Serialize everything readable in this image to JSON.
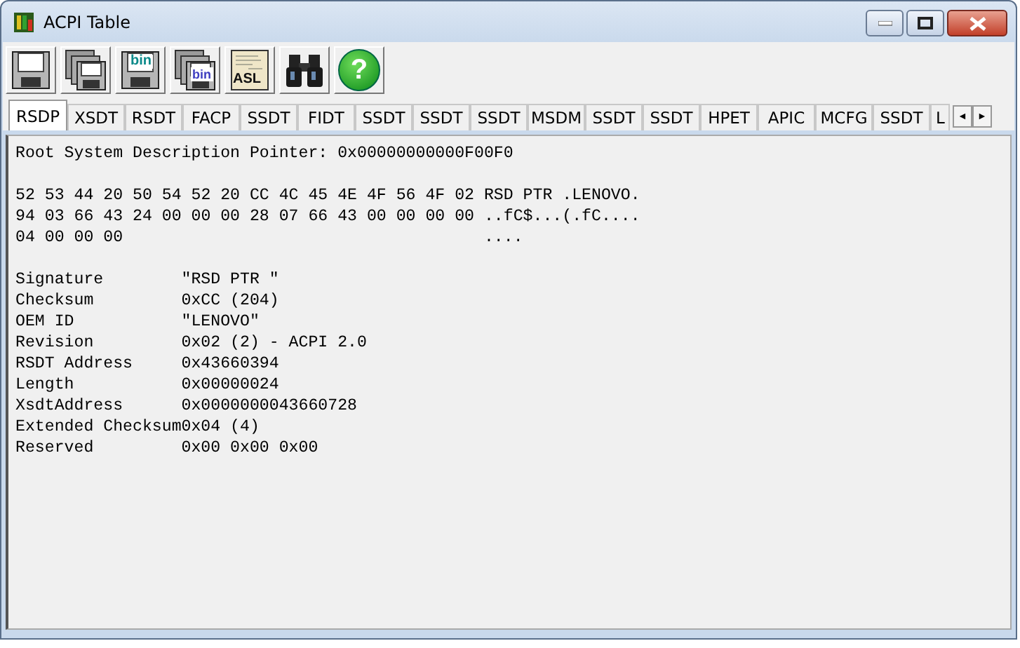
{
  "window": {
    "title": "ACPI Table"
  },
  "toolbar": [
    {
      "kind": "save"
    },
    {
      "kind": "save-all"
    },
    {
      "kind": "save",
      "label": "bin"
    },
    {
      "kind": "save-all",
      "label": "bin"
    },
    {
      "kind": "document",
      "label": "ASL"
    },
    {
      "kind": "find"
    },
    {
      "kind": "help",
      "label": "?"
    }
  ],
  "tabs": [
    {
      "label": "RSDP",
      "selected": true
    },
    {
      "label": "XSDT",
      "selected": false
    },
    {
      "label": "RSDT",
      "selected": false
    },
    {
      "label": "FACP",
      "selected": false
    },
    {
      "label": "SSDT",
      "selected": false
    },
    {
      "label": "FIDT",
      "selected": false
    },
    {
      "label": "SSDT",
      "selected": false
    },
    {
      "label": "SSDT",
      "selected": false
    },
    {
      "label": "SSDT",
      "selected": false
    },
    {
      "label": "MSDM",
      "selected": false
    },
    {
      "label": "SSDT",
      "selected": false
    },
    {
      "label": "SSDT",
      "selected": false
    },
    {
      "label": "HPET",
      "selected": false
    },
    {
      "label": "APIC",
      "selected": false
    },
    {
      "label": "MCFG",
      "selected": false
    },
    {
      "label": "SSDT",
      "selected": false
    },
    {
      "label": "L",
      "selected": false
    }
  ],
  "tab_scroll": {
    "left": "◄",
    "right": "►"
  },
  "content": {
    "heading": "Root System Description Pointer: 0x00000000000F00F0",
    "hex_dump": [
      {
        "hex": "52 53 44 20 50 54 52 20 CC 4C 45 4E 4F 56 4F 02",
        "ascii": "RSD PTR .LENOVO."
      },
      {
        "hex": "94 03 66 43 24 00 00 00 28 07 66 43 00 00 00 00",
        "ascii": "..fC$...(.fC...."
      },
      {
        "hex": "04 00 00 00",
        "ascii": "...."
      }
    ],
    "fields": [
      {
        "label": "Signature",
        "value": "\"RSD PTR \""
      },
      {
        "label": "Checksum",
        "value": "0xCC (204)"
      },
      {
        "label": "OEM ID",
        "value": "\"LENOVO\""
      },
      {
        "label": "Revision",
        "value": "0x02 (2) - ACPI 2.0"
      },
      {
        "label": "RSDT Address",
        "value": "0x43660394"
      },
      {
        "label": "Length",
        "value": "0x00000024"
      },
      {
        "label": "XsdtAddress",
        "value": "0x0000000043660728"
      },
      {
        "label": "Extended Checksum",
        "value": "0x04 (4)"
      },
      {
        "label": "Reserved",
        "value": "0x00 0x00 0x00"
      }
    ]
  }
}
